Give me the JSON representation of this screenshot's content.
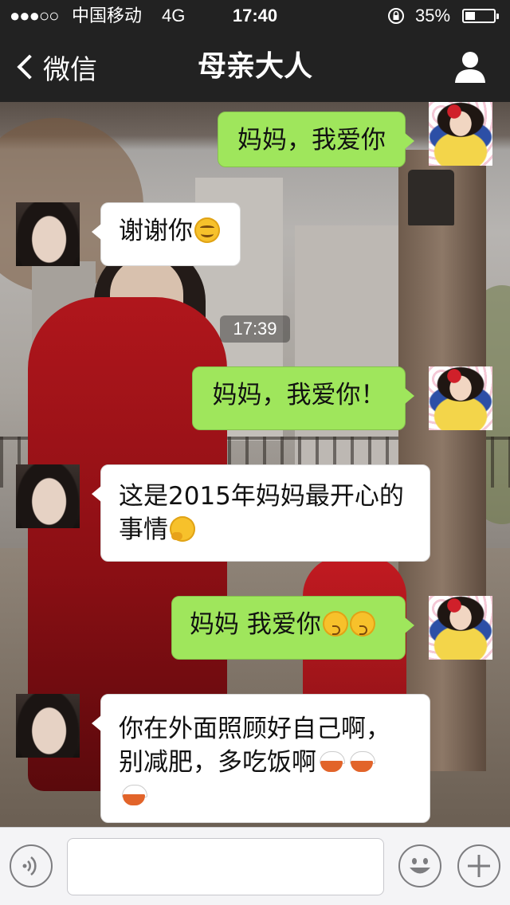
{
  "status_bar": {
    "signal": "●●●○○",
    "carrier": "中国移动",
    "network": "4G",
    "time": "17:40",
    "battery_percent": "35%",
    "battery_level": 0.35,
    "lock_icon": "rotation-lock-icon"
  },
  "nav": {
    "back_label": "微信",
    "title": "母亲大人",
    "profile_icon": "person-icon"
  },
  "messages": [
    {
      "from": "me",
      "text": "妈妈，我爱你"
    },
    {
      "from": "mom",
      "text": "谢谢你",
      "emoji": "smile-emoji"
    },
    {
      "from": "me",
      "text": "妈妈，我爱你！"
    },
    {
      "from": "mom",
      "line1": "这是2015年妈妈最开心的",
      "line2": "事情",
      "emoji": "thinking-emoji"
    },
    {
      "from": "me",
      "text": "妈妈 我爱你",
      "emoji": "kissing-emoji"
    },
    {
      "from": "mom",
      "line1": "你在外面照顾好自己啊，",
      "line2": "别减肥，多吃饭啊",
      "emoji": "rice-bowl-emoji"
    }
  ],
  "timestamp": "17:39",
  "input": {
    "value": "",
    "voice_icon": "voice-icon",
    "emoji_icon": "emoji-face-icon",
    "plus_icon": "plus-icon"
  },
  "colors": {
    "nav_bg": "#222222",
    "outgoing_bubble": "#9fe65c",
    "incoming_bubble": "#ffffff"
  }
}
